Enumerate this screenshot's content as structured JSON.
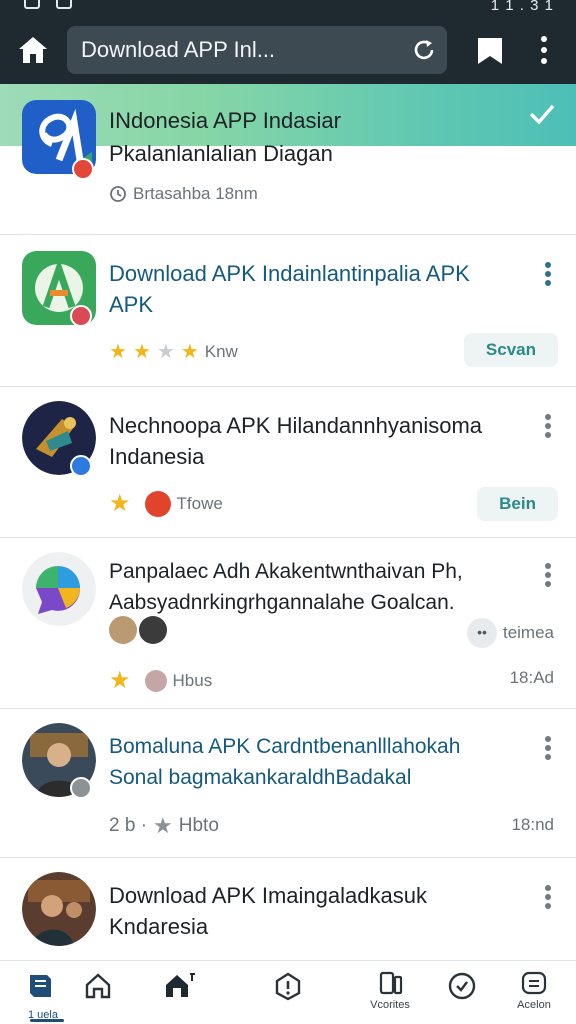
{
  "status_bar": {
    "time": "1 1 . 3 1"
  },
  "browser": {
    "url_text": "Download APP Inl...",
    "icons": [
      "home-icon",
      "reload-icon",
      "bookmark-icon",
      "more-vertical-icon"
    ]
  },
  "list": {
    "items": [
      {
        "title": "INdonesia APP Indasiar",
        "subtitle": "Pkalanlanlalian Diagan",
        "meta_text": "Brtasahba 18nm",
        "icon": "app-logo-a-blue-icon",
        "selected": true
      },
      {
        "title": "Download APK Indainlantinpalia APK APK",
        "meta_text": "Knw",
        "rating": 3,
        "action_label": "Scvan",
        "icon": "app-logo-a-green-icon"
      },
      {
        "title": "Nechnoopa APK Hilandannhyanisoma Indanesia",
        "meta_text": "Tfowe",
        "action_label": "Bein",
        "icon": "game-emblem-icon"
      },
      {
        "title": "Panpalaec Adh Akakentwnthaivan Ph, Aabsyadnrkingrhgannalahe Goalcan.",
        "meta_text": "Hbus",
        "extra_text": "teimea",
        "time": "18:Ad",
        "icon": "chat-bubble-icon"
      },
      {
        "title": "Bomaluna APK Cardntbenanlllahokah Sonal bagmakankaraldhBadakal",
        "meta_prefix": "2 b ·",
        "meta_text": "Hbto",
        "time": "18:nd",
        "icon": "user-avatar-icon"
      },
      {
        "title": "Download APK Imaingaladkasuk Kndaresia",
        "icon": "group-photo-icon"
      }
    ]
  },
  "bottom_nav": {
    "items": [
      {
        "label": "",
        "icon": "library-icon",
        "active": true
      },
      {
        "label": "",
        "icon": "home-outline-icon"
      },
      {
        "label": "",
        "icon": "store-icon"
      },
      {
        "label": "",
        "icon": "alert-shield-icon"
      },
      {
        "label": "Vcorites",
        "icon": "phone-icon"
      },
      {
        "label": "",
        "icon": "history-icon"
      },
      {
        "label": "Acelon",
        "icon": "account-icon"
      }
    ],
    "active_label": "1 uela"
  },
  "colors": {
    "topbar": "#1f2a30",
    "banner_start": "#9edbb8",
    "banner_end": "#4dbfb7",
    "title_teal": "#155a7e",
    "star": "#f2b51c"
  }
}
